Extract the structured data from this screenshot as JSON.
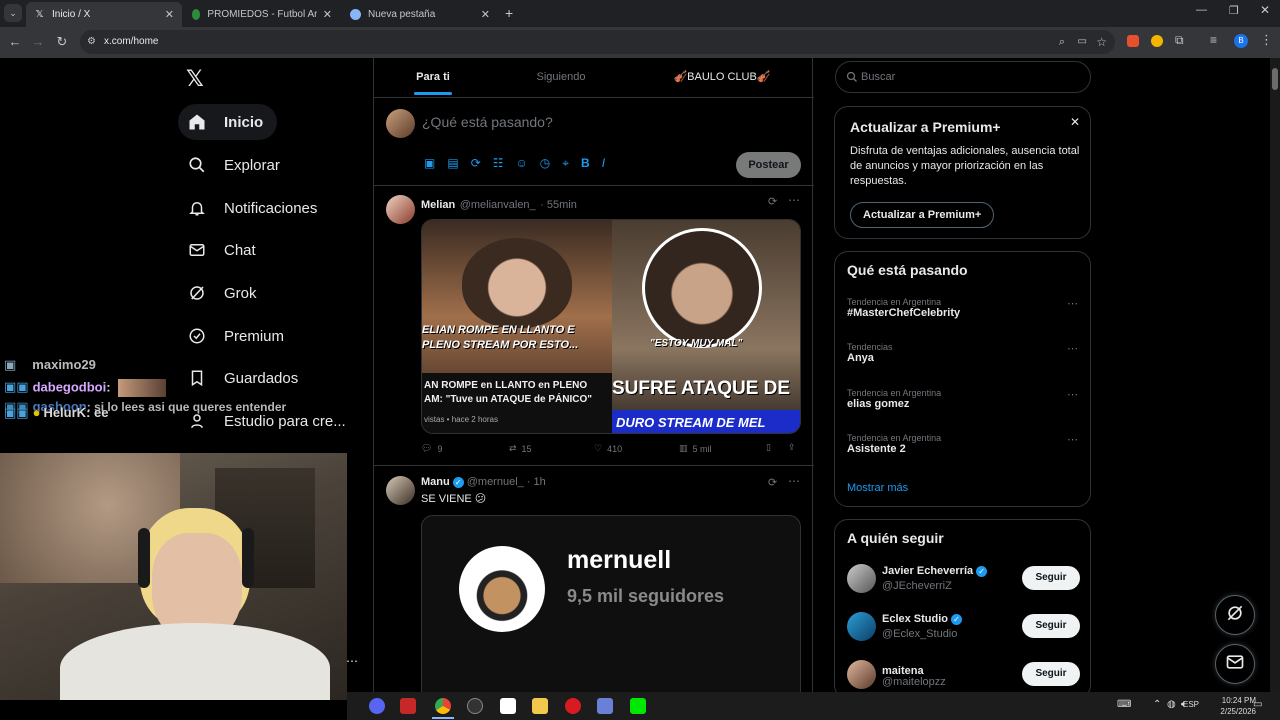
{
  "browser": {
    "tabs": [
      {
        "title": "Inicio / X",
        "favicon": "x-logo"
      },
      {
        "title": "PROMIEDOS - Futbol Argentino",
        "favicon": "promiedos-icon"
      },
      {
        "title": "Nueva pestaña",
        "favicon": "chrome-icon"
      }
    ],
    "url": "x.com/home",
    "profile_initial": "B"
  },
  "nav": {
    "items": [
      {
        "label": "Inicio",
        "icon": "home-icon"
      },
      {
        "label": "Explorar",
        "icon": "search-icon"
      },
      {
        "label": "Notificaciones",
        "icon": "bell-icon"
      },
      {
        "label": "Chat",
        "icon": "mail-icon"
      },
      {
        "label": "Grok",
        "icon": "grok-icon"
      },
      {
        "label": "Premium",
        "icon": "verified-icon"
      },
      {
        "label": "Guardados",
        "icon": "bookmark-icon"
      },
      {
        "label": "Estudio para cre...",
        "icon": "studio-icon"
      }
    ]
  },
  "feed": {
    "tabs": [
      "Para ti",
      "Siguiendo",
      "🎻BAULO CLUB🎻"
    ],
    "compose": {
      "placeholder": "¿Qué está pasando?",
      "post_label": "Postear"
    },
    "posts": [
      {
        "name": "Melian",
        "handle": "@melianvalen_",
        "time": "· 55min",
        "verified": false,
        "media_left": {
          "caption_top": "ELIAN ROMPE EN LLANTO E",
          "caption_mid": "PLENO STREAM POR ESTO...",
          "headline": "AN ROMPE en LLANTO en PLENO",
          "headline2": "AM: \"Tuve un ATAQUE de PÁNICO\"",
          "meta": "vistas • hace 2 horas"
        },
        "media_right": {
          "bubble": "\"ESTOY MUY MAL\"",
          "banner": "SUFRE ATAQUE DE",
          "banner2": "DURO STREAM DE MEL"
        },
        "stats": {
          "replies": "9",
          "reposts": "15",
          "likes": "410",
          "views": "5 mil"
        }
      },
      {
        "name": "Manu",
        "handle": "@mernuel_",
        "time": "· 1h",
        "verified": true,
        "text": "SE VIENE 😕",
        "media": {
          "username": "mernuell",
          "followers": "9,5 mil seguidores"
        }
      }
    ]
  },
  "sidebar": {
    "search_placeholder": "Buscar",
    "premium": {
      "title": "Actualizar a Premium+",
      "body": "Disfruta de ventajas adicionales, ausencia total de anuncios y mayor priorización en las respuestas.",
      "button": "Actualizar a Premium+"
    },
    "trends": {
      "title": "Qué está pasando",
      "items": [
        {
          "context": "Tendencia en Argentina",
          "name": "#MasterChefCelebrity"
        },
        {
          "context": "Tendencias",
          "name": "Anya"
        },
        {
          "context": "Tendencia en Argentina",
          "name": "elias gomez"
        },
        {
          "context": "Tendencia en Argentina",
          "name": "Asistente 2"
        }
      ],
      "more": "Mostrar más"
    },
    "follow": {
      "title": "A quién seguir",
      "items": [
        {
          "name": "Javier Echeverría",
          "handle": "@JEcheverriZ",
          "verified": true
        },
        {
          "name": "Eclex Studio",
          "handle": "@Eclex_Studio",
          "verified": true
        },
        {
          "name": "maitena",
          "handle": "@maitelopzz",
          "verified": false
        }
      ],
      "button": "Seguir"
    }
  },
  "overlay_chat": [
    {
      "user": "maximo29",
      "text": ""
    },
    {
      "user": "dabegodboi",
      "text": ":"
    },
    {
      "user": "gashoon",
      "text": ": si lo lees asi que queres entender"
    },
    {
      "user": "HelurK",
      "text": ": ee"
    }
  ],
  "taskbar": {
    "lang": "ESP",
    "time": "10:24 PM",
    "date": "2/25/2026"
  },
  "colors": {
    "accent": "#1d9bf0",
    "border": "#2f3336",
    "muted": "#71767b"
  }
}
